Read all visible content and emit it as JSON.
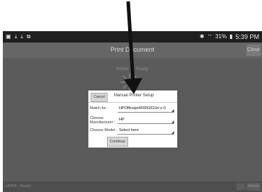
{
  "status_bar": {
    "left_icons": [
      "image-icon",
      "download-icon",
      "download-icon",
      "cast-icon"
    ],
    "right_icons": [
      "bluetooth-icon",
      "wifi-icon",
      "battery-icon"
    ],
    "battery_percent": "31%",
    "time": "5:39 PM"
  },
  "header": {
    "title": "Print Document",
    "close_label": "Close"
  },
  "background": {
    "label_left": "Printer",
    "label_right": "Ready"
  },
  "dialog": {
    "cancel_label": "Cancel",
    "title": "Manual Printer Setup",
    "match_for_label": "Match for :",
    "match_for_value": "HPOfficejet4500G510n-z-0",
    "manufacturer_label_line1": "Choose",
    "manufacturer_label_line2": "Manufacturer :",
    "manufacturer_value": "HP",
    "model_label": "Choose Model :",
    "model_value": "Select here",
    "continue_label": "Continue"
  },
  "footer": {
    "status": "HGKB : Ready",
    "admin_label": "Admin"
  },
  "colors": {
    "overlay": "#5b5b5b",
    "status_bar": "#1f1f1f",
    "arrow": "#111111"
  }
}
